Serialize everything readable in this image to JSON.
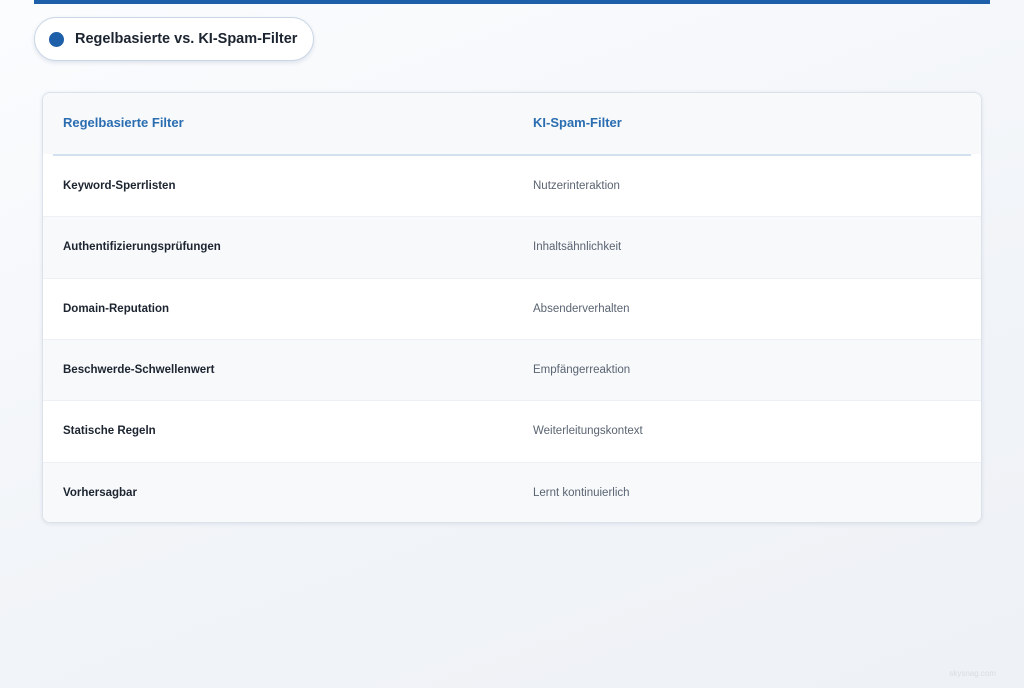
{
  "title": "Regelbasierte vs. KI-Spam-Filter",
  "colors": {
    "accent": "#1d5fa8",
    "header_text": "#2a6db1"
  },
  "table": {
    "headers": [
      "Regelbasierte Filter",
      "KI-Spam-Filter"
    ],
    "rows": [
      [
        "Keyword-Sperrlisten",
        "Nutzerinteraktion"
      ],
      [
        "Authentifizierungsprüfungen",
        "Inhaltsähnlichkeit"
      ],
      [
        "Domain-Reputation",
        "Absenderverhalten"
      ],
      [
        "Beschwerde-Schwellenwert",
        "Empfängerreaktion"
      ],
      [
        "Statische Regeln",
        "Weiterleitungskontext"
      ],
      [
        "Vorhersagbar",
        "Lernt kontinuierlich"
      ]
    ]
  },
  "watermark": "skysnag.com"
}
